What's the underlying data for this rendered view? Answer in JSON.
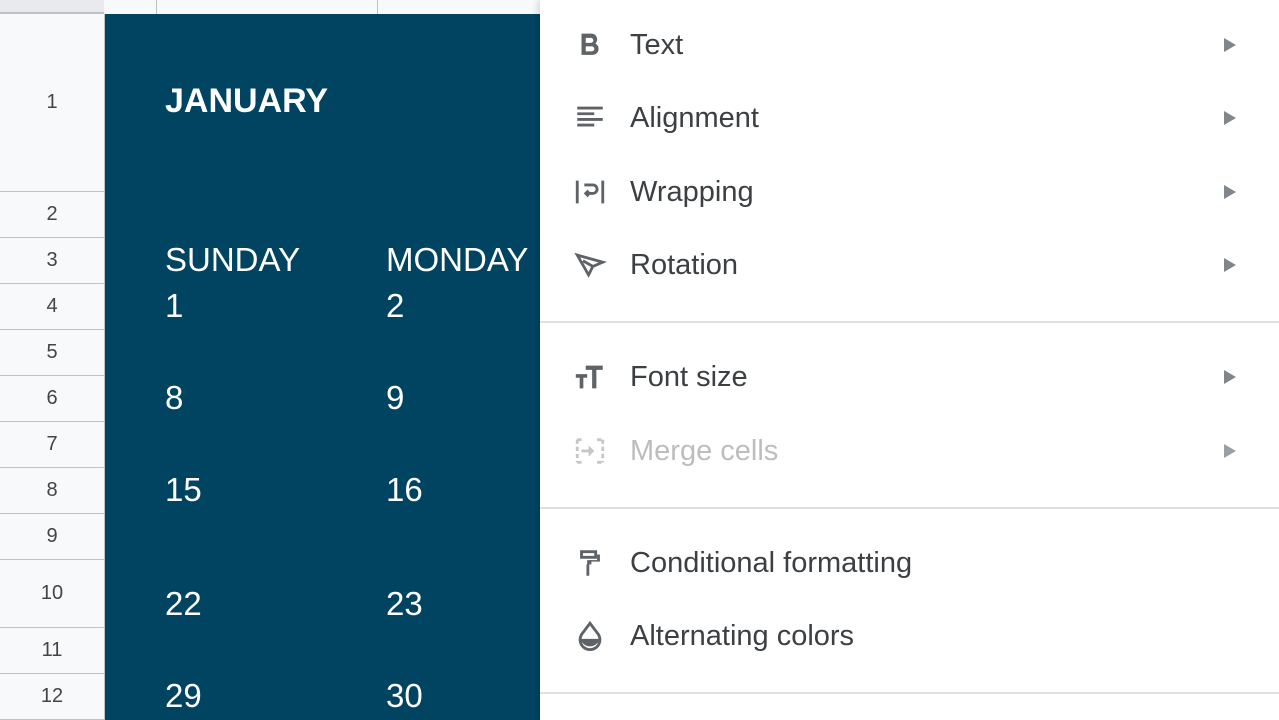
{
  "sheet": {
    "row_headers": [
      "1",
      "2",
      "3",
      "4",
      "5",
      "6",
      "7",
      "8",
      "9",
      "10",
      "11",
      "12"
    ],
    "calendar_color": "#004461",
    "month": "JANUARY",
    "days": [
      "SUNDAY",
      "MONDAY"
    ],
    "dates": {
      "col1": [
        "1",
        "8",
        "15",
        "22",
        "29"
      ],
      "col2": [
        "2",
        "9",
        "16",
        "23",
        "30"
      ]
    }
  },
  "menu": {
    "items": [
      {
        "label": "Text",
        "icon": "bold-icon",
        "submenu": true,
        "enabled": true
      },
      {
        "label": "Alignment",
        "icon": "align-left-icon",
        "submenu": true,
        "enabled": true
      },
      {
        "label": "Wrapping",
        "icon": "text-wrap-icon",
        "submenu": true,
        "enabled": true
      },
      {
        "label": "Rotation",
        "icon": "text-rotation-icon",
        "submenu": true,
        "enabled": true
      },
      {
        "label": "Font size",
        "icon": "font-size-icon",
        "submenu": true,
        "enabled": true
      },
      {
        "label": "Merge cells",
        "icon": "merge-cells-icon",
        "submenu": true,
        "enabled": false
      },
      {
        "label": "Conditional formatting",
        "icon": "paint-roller-icon",
        "submenu": false,
        "enabled": true
      },
      {
        "label": "Alternating colors",
        "icon": "fill-drop-icon",
        "submenu": false,
        "enabled": true
      }
    ]
  }
}
